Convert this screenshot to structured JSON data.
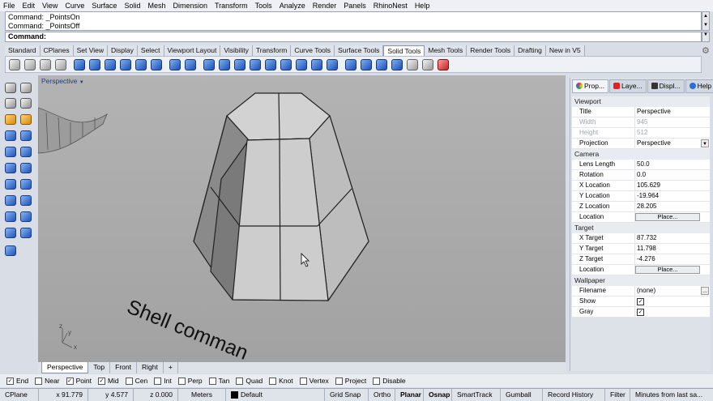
{
  "menu": [
    "File",
    "Edit",
    "View",
    "Curve",
    "Surface",
    "Solid",
    "Mesh",
    "Dimension",
    "Transform",
    "Tools",
    "Analyze",
    "Render",
    "Panels",
    "RhinoNest",
    "Help"
  ],
  "command_history": [
    "Command: _PointsOn",
    "Command: _PointsOff"
  ],
  "command_prompt": "Command:",
  "toolbar_tabs": [
    "Standard",
    "CPlanes",
    "Set View",
    "Display",
    "Select",
    "Viewport Layout",
    "Visibility",
    "Transform",
    "Curve Tools",
    "Surface Tools",
    "Solid Tools",
    "Mesh Tools",
    "Render Tools",
    "Drafting",
    "New in V5"
  ],
  "active_toolbar_tab": "Solid Tools",
  "viewport": {
    "label": "Perspective",
    "overlay_text": "Shell comman",
    "axis_labels": {
      "x": "x",
      "y": "y",
      "z": "z"
    },
    "tabs": [
      "Perspective",
      "Top",
      "Front",
      "Right"
    ],
    "add_tab_symbol": "+"
  },
  "panel": {
    "tabs": [
      "Prop...",
      "Laye...",
      "Displ...",
      "Help"
    ],
    "sections": {
      "viewport": {
        "header": "Viewport",
        "title_key": "Title",
        "title_val": "Perspective",
        "width_key": "Width",
        "width_val": "945",
        "height_key": "Height",
        "height_val": "512",
        "proj_key": "Projection",
        "proj_val": "Perspective"
      },
      "camera": {
        "header": "Camera",
        "lens_key": "Lens Length",
        "lens_val": "50.0",
        "rot_key": "Rotation",
        "rot_val": "0.0",
        "xloc_key": "X Location",
        "xloc_val": "105.629",
        "yloc_key": "Y Location",
        "yloc_val": "-19.964",
        "zloc_key": "Z Location",
        "zloc_val": "28.205",
        "loc_key": "Location",
        "place_btn": "Place..."
      },
      "target": {
        "header": "Target",
        "xt_key": "X Target",
        "xt_val": "87.732",
        "yt_key": "Y Target",
        "yt_val": "11.798",
        "zt_key": "Z Target",
        "zt_val": "-4.276",
        "loc_key": "Location",
        "place_btn": "Place..."
      },
      "wallpaper": {
        "header": "Wallpaper",
        "file_key": "Filename",
        "file_val": "(none)",
        "browse_btn": "...",
        "show_key": "Show",
        "gray_key": "Gray"
      }
    }
  },
  "osnaps": [
    {
      "label": "End",
      "checked": true
    },
    {
      "label": "Near",
      "checked": false
    },
    {
      "label": "Point",
      "checked": true
    },
    {
      "label": "Mid",
      "checked": true
    },
    {
      "label": "Cen",
      "checked": false
    },
    {
      "label": "Int",
      "checked": false
    },
    {
      "label": "Perp",
      "checked": false
    },
    {
      "label": "Tan",
      "checked": false
    },
    {
      "label": "Quad",
      "checked": false
    },
    {
      "label": "Knot",
      "checked": false
    },
    {
      "label": "Vertex",
      "checked": false
    },
    {
      "label": "Project",
      "checked": false
    },
    {
      "label": "Disable",
      "checked": false
    }
  ],
  "status": {
    "cplane": "CPlane",
    "x": "x 91.779",
    "y": "y 4.577",
    "z": "z 0.000",
    "units": "Meters",
    "layer": "Default",
    "grid_snap": "Grid Snap",
    "ortho": "Ortho",
    "planar": "Planar",
    "osnap": "Osnap",
    "smarttrack": "SmartTrack",
    "gumball": "Gumball",
    "record_history": "Record History",
    "filter": "Filter",
    "message": "Minutes from last sa..."
  }
}
